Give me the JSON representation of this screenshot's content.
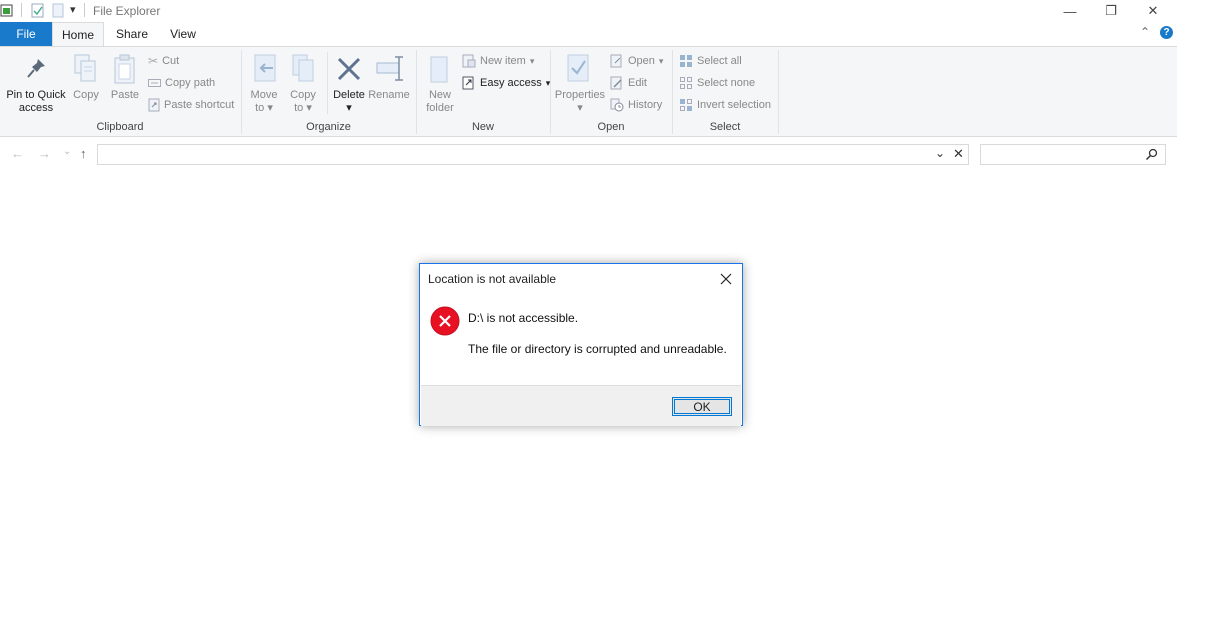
{
  "window": {
    "title": "File Explorer",
    "quick_access_dropdown": "▾",
    "controls": {
      "minimize": "—",
      "restore": "❐",
      "close": "✕"
    }
  },
  "tabs": {
    "file": "File",
    "home": "Home",
    "share": "Share",
    "view": "View",
    "collapse_icon": "⌃",
    "help_icon": "?"
  },
  "ribbon": {
    "clipboard": {
      "label": "Clipboard",
      "pin": "Pin to Quick access",
      "copy": "Copy",
      "paste": "Paste",
      "cut": "Cut",
      "copy_path": "Copy path",
      "paste_shortcut": "Paste shortcut"
    },
    "organize": {
      "label": "Organize",
      "move_to": "Move to",
      "copy_to": "Copy to",
      "delete": "Delete",
      "rename": "Rename"
    },
    "new": {
      "label": "New",
      "new_folder": "New folder",
      "new_item": "New item",
      "easy_access": "Easy access"
    },
    "open": {
      "label": "Open",
      "properties": "Properties",
      "open": "Open",
      "edit": "Edit",
      "history": "History"
    },
    "select": {
      "label": "Select",
      "select_all": "Select all",
      "select_none": "Select none",
      "invert_selection": "Invert selection"
    }
  },
  "address_bar": {
    "back": "←",
    "forward": "→",
    "recent": "⌄",
    "up": "↑",
    "path": "",
    "search_placeholder": ""
  },
  "dialog": {
    "title": "Location is not available",
    "message": "D:\\ is not accessible.",
    "detail": "The file or directory is corrupted and unreadable.",
    "ok": "OK",
    "error_color": "#e81123"
  }
}
